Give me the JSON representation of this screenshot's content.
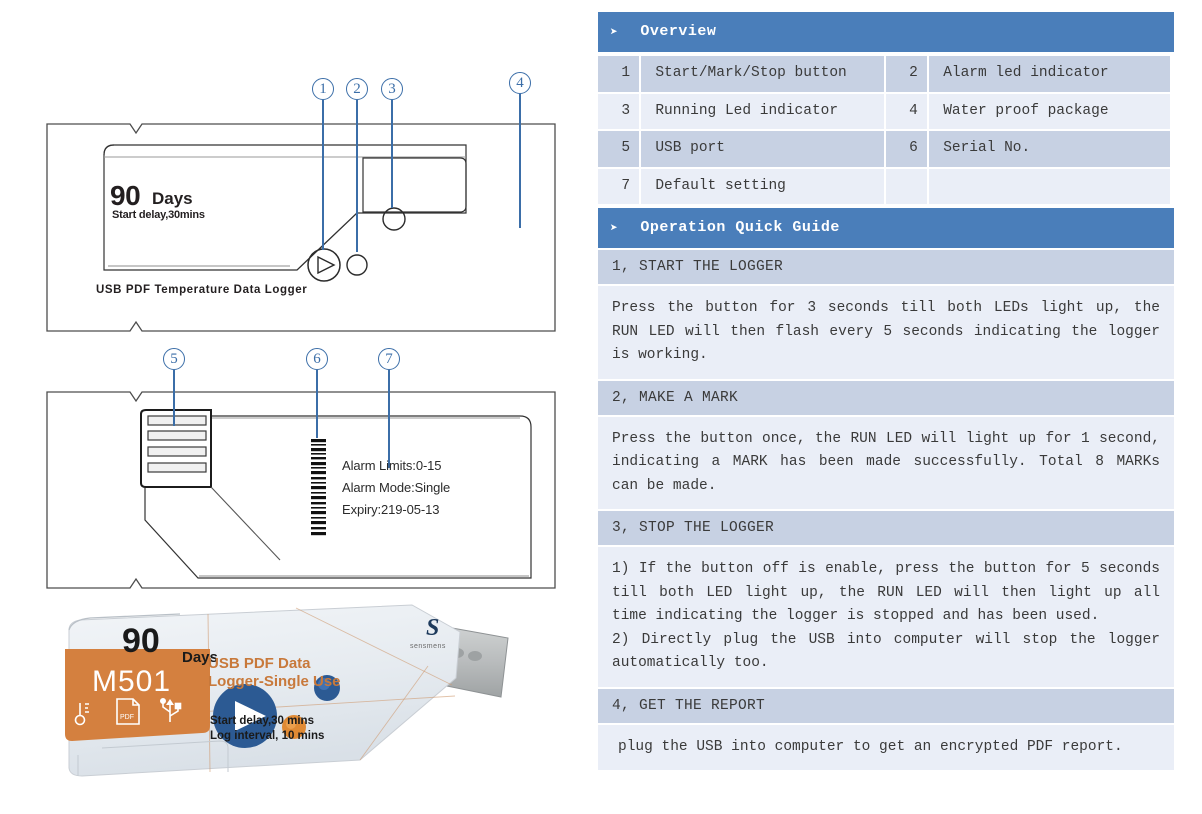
{
  "overview": {
    "section_title": "Overview",
    "arrow_glyph": "➤",
    "rows": [
      [
        {
          "num": "1",
          "text": "Start/Mark/Stop button"
        },
        {
          "num": "2",
          "text": "Alarm led indicator"
        }
      ],
      [
        {
          "num": "3",
          "text": "Running Led indicator"
        },
        {
          "num": "4",
          "text": "Water proof package"
        }
      ],
      [
        {
          "num": "5",
          "text": "USB port"
        },
        {
          "num": "6",
          "text": "Serial No."
        }
      ],
      [
        {
          "num": "7",
          "text": "Default setting"
        },
        {
          "num": "",
          "text": ""
        }
      ]
    ]
  },
  "guide": {
    "section_title": "Operation Quick Guide",
    "steps": [
      {
        "title": "1, START THE LOGGER",
        "body": "Press the button for 3 seconds till both LEDs light up, the RUN LED will then flash every 5 seconds indicating the logger is working."
      },
      {
        "title": "2, MAKE A MARK",
        "body": "Press the button once, the RUN LED will light up for 1 second, indicating a MARK has been made successfully. Total 8 MARKs can be made."
      },
      {
        "title": "3, STOP THE LOGGER",
        "body": "1) If the button off is enable, press the button for 5 seconds till both LED light up, the RUN LED will then light up all time indicating the logger is stopped and has been used.\n2) Directly plug the USB into computer will stop the logger automatically too."
      },
      {
        "title": "4, GET THE REPORT",
        "body": " plug the USB into computer to get an encrypted PDF report."
      }
    ]
  },
  "diagram_front": {
    "callouts": [
      "1",
      "2",
      "3",
      "4"
    ],
    "big_number": "90",
    "days_label": "Days",
    "start_delay": "Start delay,30mins",
    "strip_label": "USB PDF Temperature Data Logger"
  },
  "diagram_back": {
    "callouts": [
      "5",
      "6",
      "7"
    ],
    "alarm_limits": "Alarm Limits:0-15",
    "alarm_mode": "Alarm Mode:Single",
    "expiry": "Expiry:219-05-13"
  },
  "photo": {
    "big_number": "90",
    "days_label": "Days",
    "model": "M501",
    "product_line1": "USB PDF Data",
    "product_line2": "Logger-Single Use",
    "start_delay": "Start delay,30 mins",
    "log_interval": "Log interval, 10 mins",
    "brand_mark": "S",
    "brand_name": "sensmens",
    "icons": [
      "thermometer-icon",
      "pdf-icon",
      "usb-icon"
    ]
  },
  "colors": {
    "header_blue": "#4a7eba",
    "row_dark": "#c7d1e3",
    "row_light": "#eaeef7",
    "callout_blue": "#3b6ea8",
    "badge_orange": "#d4803f",
    "button_blue": "#2c5a93",
    "led_orange": "#e08a34"
  }
}
